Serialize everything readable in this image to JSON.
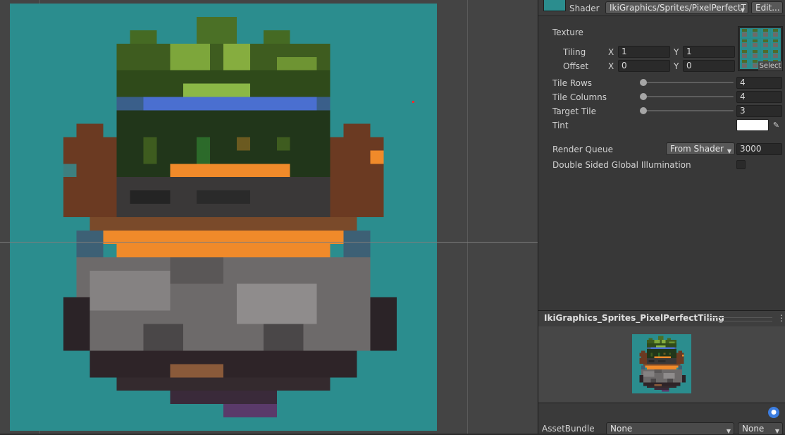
{
  "inspector": {
    "shader_label": "Shader",
    "shader_value": "IkiGraphics/Sprites/PixelPerfectT",
    "edit_button": "Edit...",
    "texture_label": "Texture",
    "tiling_label": "Tiling",
    "offset_label": "Offset",
    "x_label": "X",
    "y_label": "Y",
    "tiling_x": "1",
    "tiling_y": "1",
    "offset_x": "0",
    "offset_y": "0",
    "select_button": "Select",
    "tile_rows_label": "Tile Rows",
    "tile_rows_value": "4",
    "tile_columns_label": "Tile Columns",
    "tile_columns_value": "4",
    "target_tile_label": "Target Tile",
    "target_tile_value": "3",
    "tint_label": "Tint",
    "tint_color": "#ffffff",
    "render_queue_label": "Render Queue",
    "render_queue_dropdown": "From Shader",
    "render_queue_value": "3000",
    "gi_label": "Double Sided Global Illumination",
    "gi_checked": false
  },
  "preview": {
    "title": "IkiGraphics_Sprites_PixelPerfectTiling"
  },
  "asset_bundle": {
    "label": "AssetBundle",
    "name_value": "None",
    "variant_value": "None"
  },
  "scene": {
    "background_color": "#2b8d8e",
    "origin_marker_color": "#ff2a2a"
  }
}
